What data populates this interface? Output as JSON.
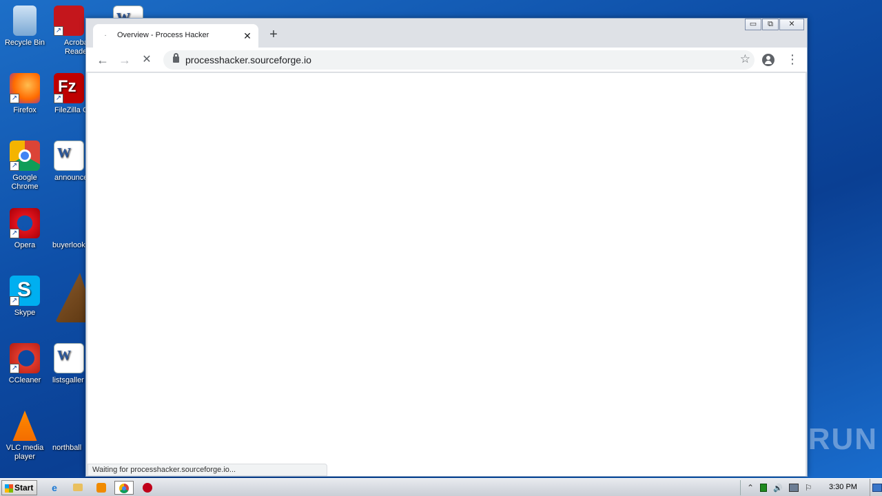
{
  "desktop": {
    "icons": [
      {
        "label": "Recycle Bin"
      },
      {
        "label": "Acrobat Reader"
      },
      {
        "label": "Firefox"
      },
      {
        "label": "FileZilla C"
      },
      {
        "label": "Google Chrome"
      },
      {
        "label": "announce"
      },
      {
        "label": "Opera"
      },
      {
        "label": "buyerlook"
      },
      {
        "label": "Skype"
      },
      {
        "label": "CCleaner"
      },
      {
        "label": "listsgaller"
      },
      {
        "label": "VLC media player"
      },
      {
        "label": "northball"
      }
    ]
  },
  "browser": {
    "tab": {
      "title": "Overview - Process Hacker",
      "favicon": "·",
      "close_glyph": "✕"
    },
    "newtab_glyph": "+",
    "window_controls": {
      "minimize": "▭",
      "restore": "⧉",
      "close": "✕"
    },
    "toolbar": {
      "back_glyph": "←",
      "forward_glyph": "→",
      "stop_glyph": "✕",
      "url": "processhacker.sourceforge.io",
      "star_glyph": "☆",
      "menu_glyph": "⋮"
    },
    "status": "Waiting for processhacker.sourceforge.io..."
  },
  "watermark": "ANY▷RUN",
  "taskbar": {
    "start_label": "Start",
    "ie_glyph": "e",
    "clock": "3:30 PM",
    "tray": {
      "chevron": "⌃",
      "volume": "🔊",
      "flag": "⚐"
    }
  },
  "colors": {
    "accent": "#1a73e8",
    "desktop_bg": "#0e4fa8",
    "tab_bg": "#dee1e6"
  }
}
